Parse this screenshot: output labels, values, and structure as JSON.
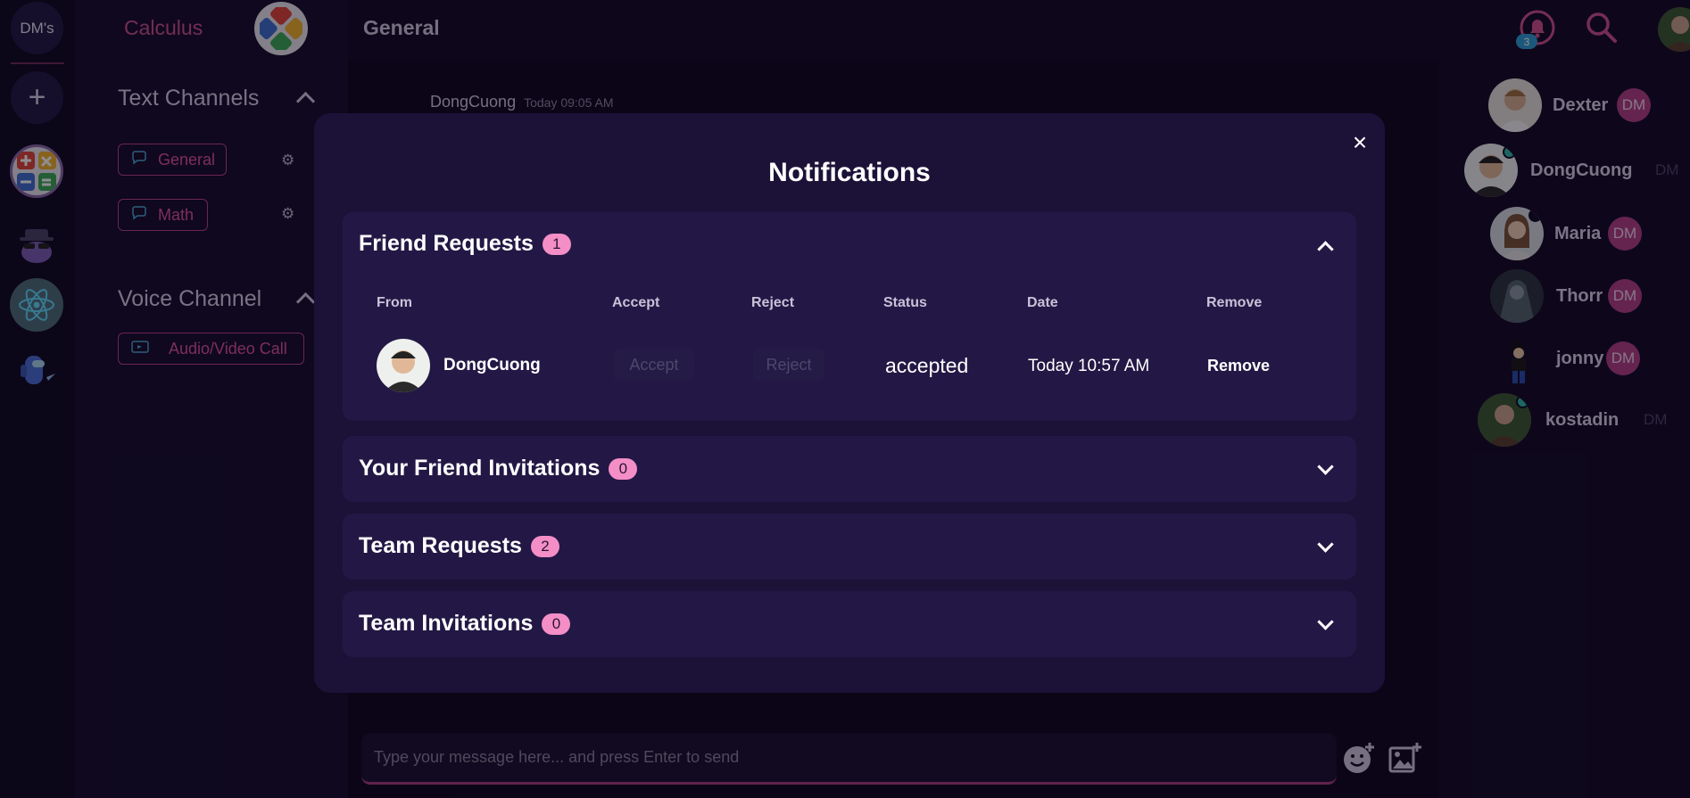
{
  "rail": {
    "dm_label": "DM's",
    "add_symbol": "+"
  },
  "header": {
    "server_name": "Calculus",
    "channel_name": "General",
    "notification_count": "3"
  },
  "sidebar": {
    "text_section": "Text Channels",
    "voice_section": "Voice Channel",
    "text_channels": [
      {
        "label": "General"
      },
      {
        "label": "Math"
      }
    ],
    "voice_channels": [
      {
        "label": "Audio/Video Call"
      }
    ]
  },
  "chat": {
    "message": {
      "author": "DongCuong",
      "time": "Today 09:05 AM"
    },
    "composer_placeholder": "Type your message here... and press Enter to send"
  },
  "members": [
    {
      "name": "Dexter",
      "dm": "DM"
    },
    {
      "name": "DongCuong",
      "dm": "DM"
    },
    {
      "name": "Maria",
      "dm": "DM"
    },
    {
      "name": "Thorr",
      "dm": "DM"
    },
    {
      "name": "jonny",
      "dm": "DM"
    },
    {
      "name": "kostadin",
      "dm": "DM"
    }
  ],
  "modal": {
    "title": "Notifications",
    "close_symbol": "×",
    "sections": [
      {
        "title": "Friend Requests",
        "count": "1"
      },
      {
        "title": "Your Friend Invitations",
        "count": "0"
      },
      {
        "title": "Team Requests",
        "count": "2"
      },
      {
        "title": "Team Invitations",
        "count": "0"
      }
    ],
    "table_headers": {
      "from": "From",
      "accept": "Accept",
      "reject": "Reject",
      "status": "Status",
      "date": "Date",
      "remove": "Remove"
    },
    "request": {
      "name": "DongCuong",
      "accept_label": "Accept",
      "reject_label": "Reject",
      "status": "accepted",
      "date": "Today 10:57 AM",
      "remove_label": "Remove"
    }
  },
  "colors": {
    "accent_pink": "#e0539f",
    "badge_pink": "#f48ec7",
    "modal_bg": "#1c1238",
    "online": "#2fb8a9"
  }
}
